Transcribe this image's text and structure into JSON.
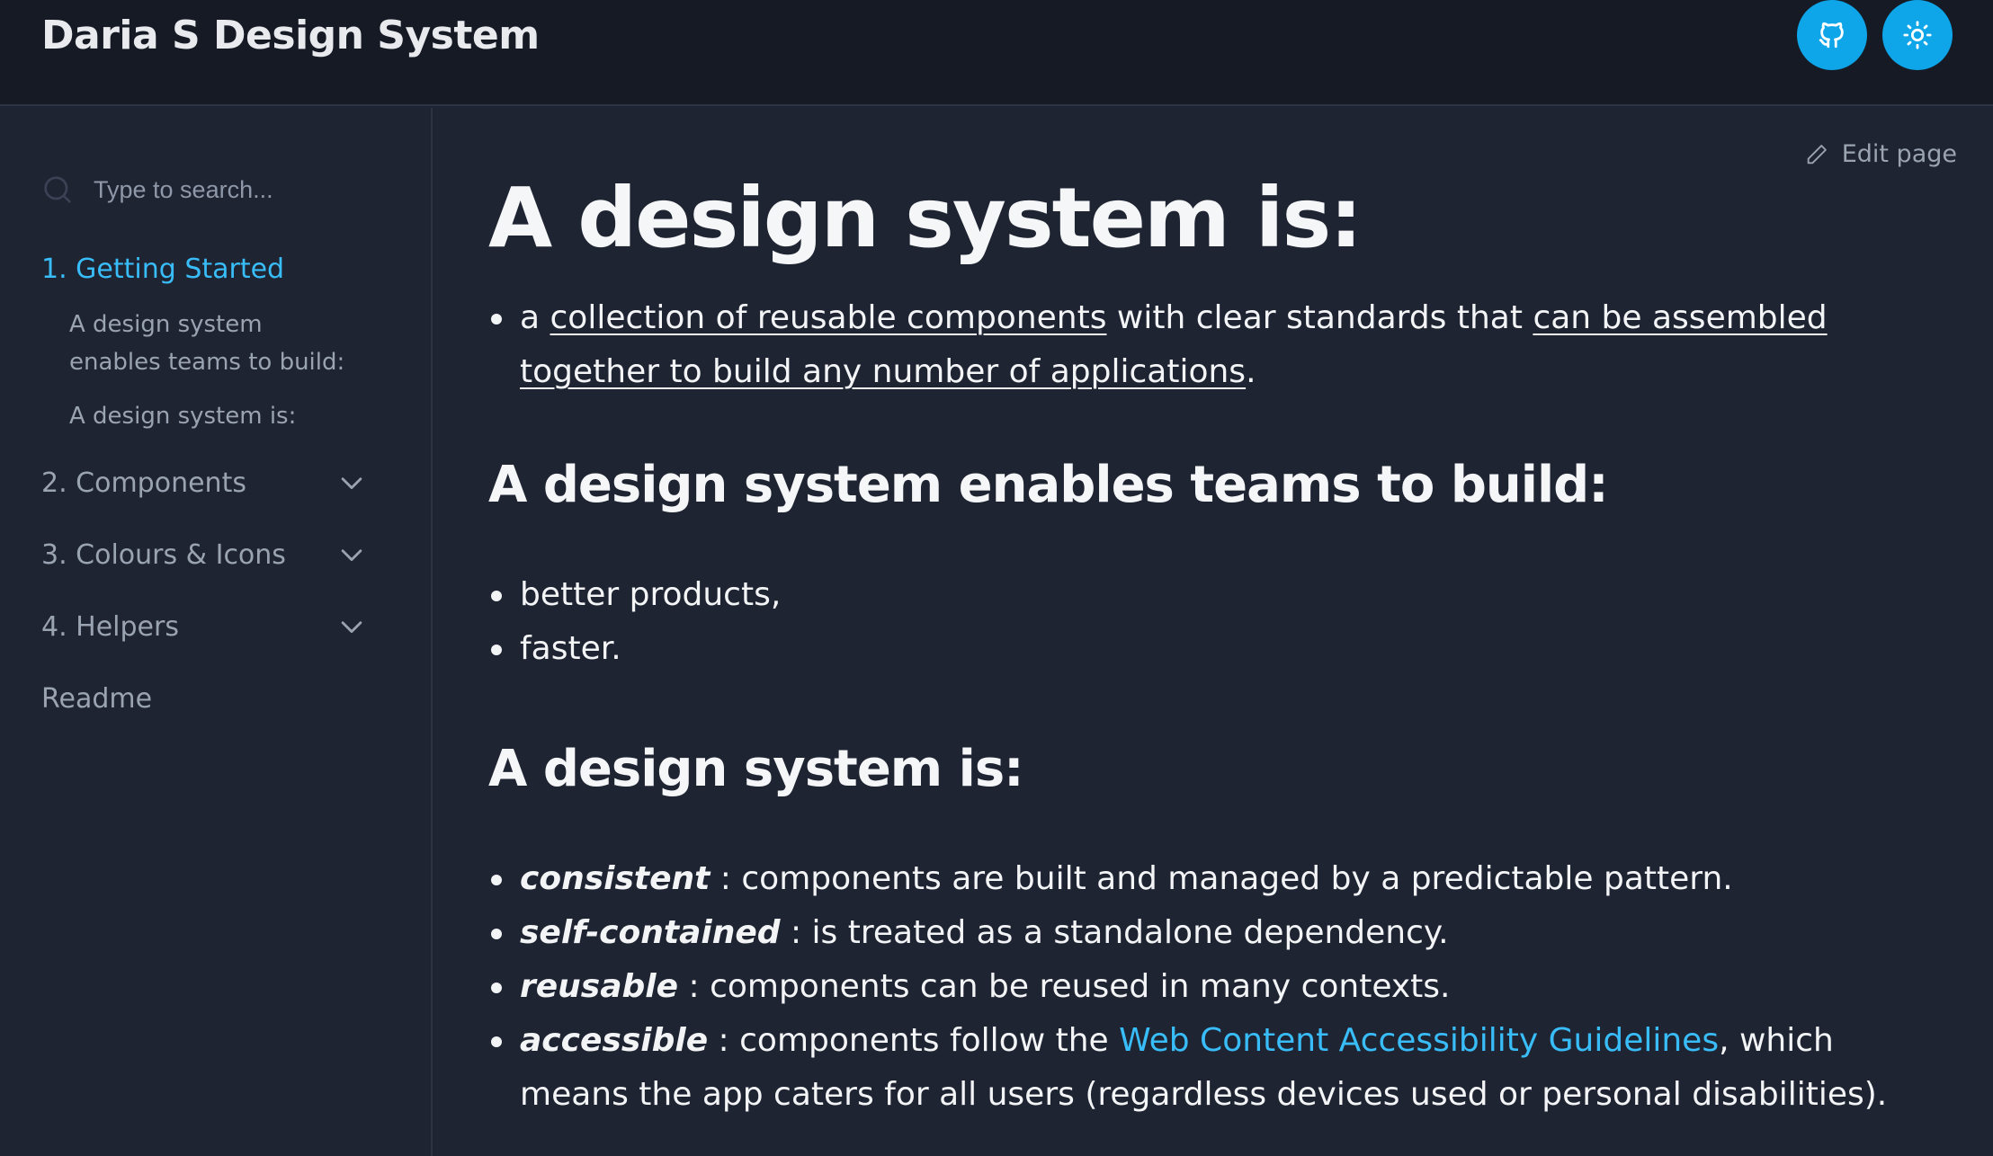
{
  "header": {
    "title": "Daria S Design System",
    "github_icon": "github-icon",
    "theme_icon": "sun-icon",
    "accent": "#0ea5e9"
  },
  "sidebar": {
    "search_placeholder": "Type to search...",
    "sections": [
      {
        "label": "1. Getting Started",
        "active": true,
        "children": [
          "A design system enables teams to build:",
          "A design system is:"
        ]
      },
      {
        "label": "2. Components",
        "expandable": true
      },
      {
        "label": "3. Colours & Icons",
        "expandable": true
      },
      {
        "label": "4. Helpers",
        "expandable": true
      },
      {
        "label": "Readme"
      }
    ]
  },
  "main": {
    "edit_label": "Edit page",
    "title": "A design system is:",
    "intro": {
      "p1": "a ",
      "link1": "collection of reusable components",
      "p2": " with clear standards that ",
      "link2": "can be assembled together to build any number of applications",
      "p3": "."
    },
    "section1": {
      "heading": "A design system enables teams to build:",
      "items": [
        "better products,",
        "faster."
      ]
    },
    "section2": {
      "heading": "A design system is:",
      "items": [
        {
          "term": "consistent",
          "text": " : components are built and managed by a predictable pattern."
        },
        {
          "term": "self-contained",
          "text": " : is treated as a standalone dependency."
        },
        {
          "term": "reusable",
          "text": " : components can be reused in many contexts."
        },
        {
          "term": "accessible",
          "text": " : components follow the ",
          "link": "Web Content Accessibility Guidelines",
          "after": ", which means the app caters for all users (regardless devices used or personal disabilities)."
        }
      ]
    },
    "link_color": "#38bdf8"
  }
}
